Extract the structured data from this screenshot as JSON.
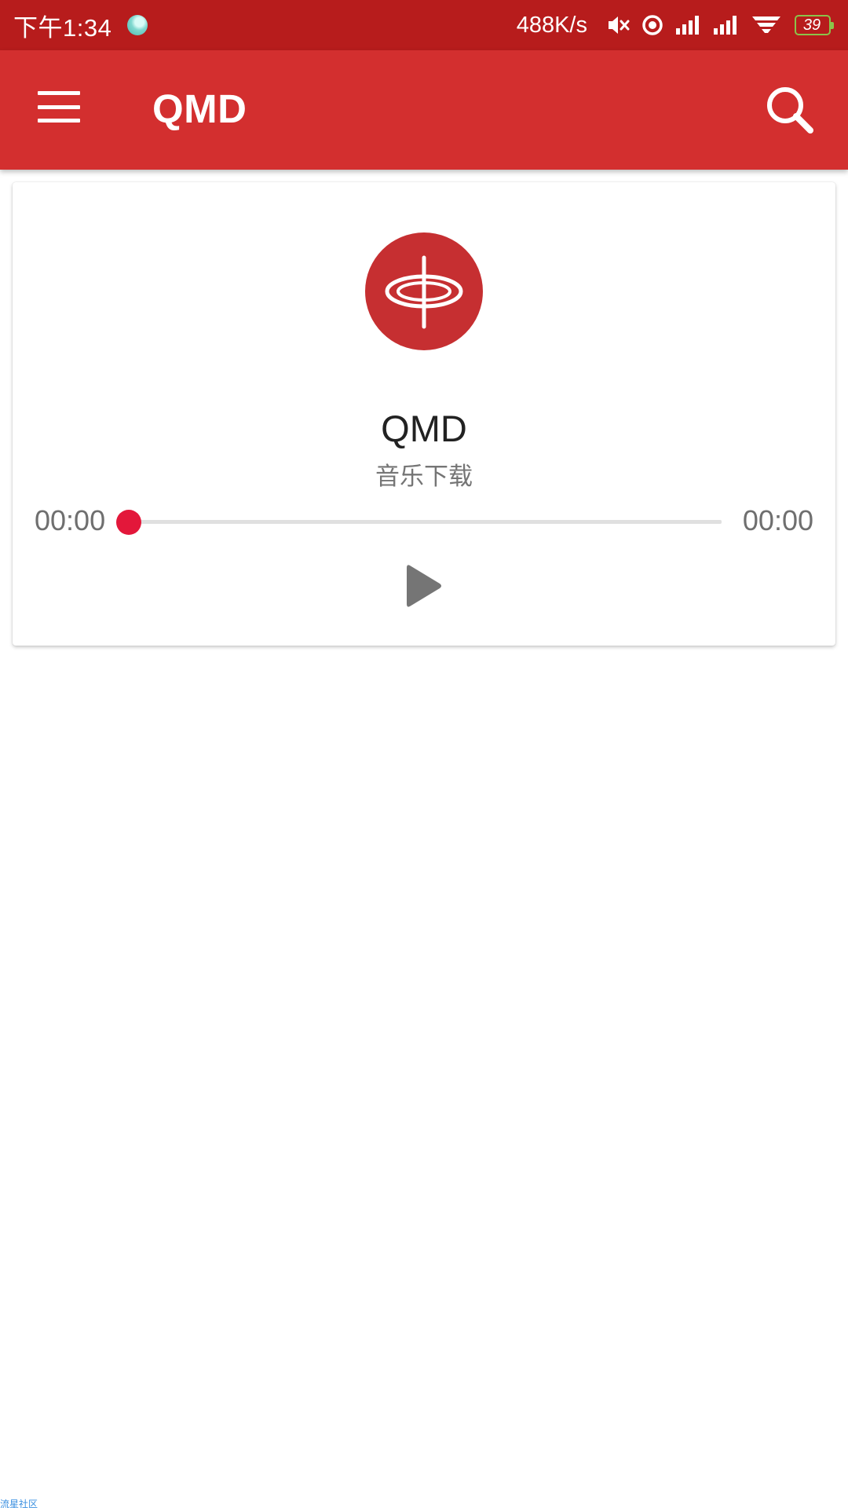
{
  "status_bar": {
    "time": "下午1:34",
    "net_speed": "488K/s",
    "battery_level": "39",
    "icons": [
      "app-notification-icon",
      "vibrate-icon",
      "location-icon",
      "signal-icon",
      "signal-icon",
      "wifi-icon",
      "battery-icon"
    ]
  },
  "app_bar": {
    "title": "QMD",
    "menu_icon": "hamburger-menu-icon",
    "search_icon": "search-icon"
  },
  "player": {
    "album_icon": "spinning-disc-icon",
    "track_title": "QMD",
    "track_subtitle": "音乐下载",
    "elapsed_time": "00:00",
    "total_time": "00:00",
    "progress": 0,
    "play_icon": "play-icon"
  },
  "watermark": "流星社区",
  "colors": {
    "status_bar": "#b71c1c",
    "app_bar": "#d32f2f",
    "album_art": "#c62f31",
    "seek_accent": "#e3173a",
    "play_icon": "#757575"
  }
}
